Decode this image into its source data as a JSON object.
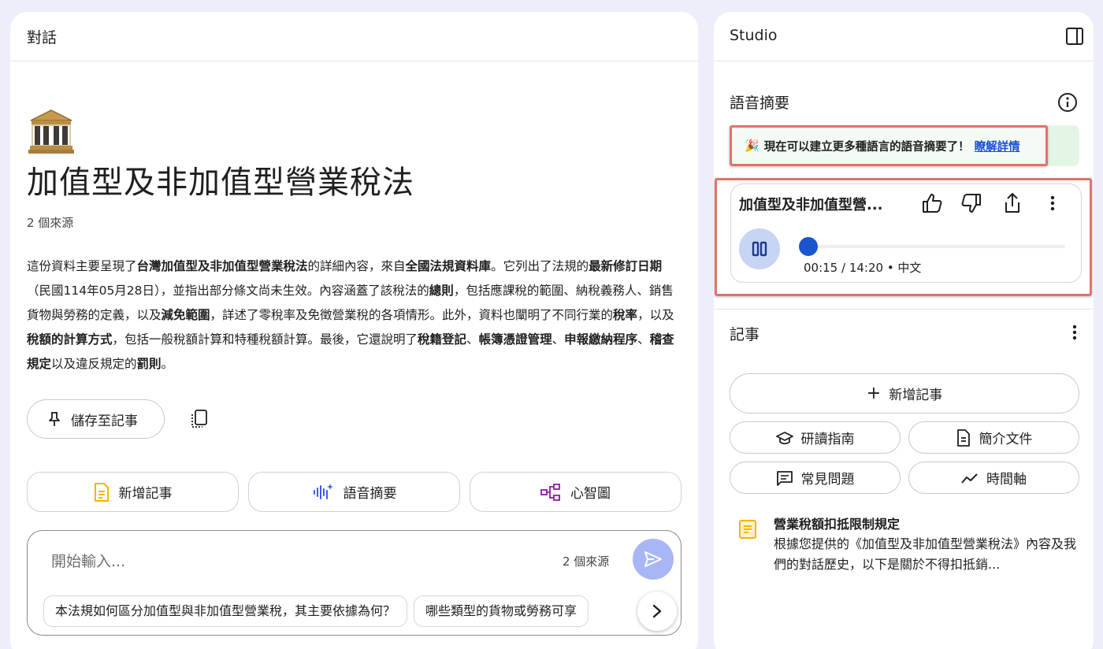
{
  "chat": {
    "header": "對話",
    "notebook_title": "加值型及非加值型營業稅法",
    "source_count": "2 個來源",
    "summary_segments": [
      {
        "text": "這份資料主要呈現了",
        "bold": false
      },
      {
        "text": "台灣加值型及非加值型營業稅法",
        "bold": true
      },
      {
        "text": "的詳細內容，來自",
        "bold": false
      },
      {
        "text": "全國法規資料庫",
        "bold": true
      },
      {
        "text": "。它列出了法規的",
        "bold": false
      },
      {
        "text": "最新修訂日期",
        "bold": true
      },
      {
        "text": "（民國114年05月28日），並指出部分條文尚未生效。內容涵蓋了該稅法的",
        "bold": false
      },
      {
        "text": "總則",
        "bold": true
      },
      {
        "text": "，包括應課稅的範圍、納稅義務人、銷售貨物與勞務的定義，以及",
        "bold": false
      },
      {
        "text": "減免範圍",
        "bold": true
      },
      {
        "text": "，詳述了零稅率及免徵營業稅的各項情形。此外，資料也闡明了不同行業的",
        "bold": false
      },
      {
        "text": "稅率",
        "bold": true
      },
      {
        "text": "，以及",
        "bold": false
      },
      {
        "text": "稅額的計算方式",
        "bold": true
      },
      {
        "text": "，包括一般稅額計算和特種稅額計算。最後，它還說明了",
        "bold": false
      },
      {
        "text": "稅籍登記",
        "bold": true
      },
      {
        "text": "、",
        "bold": false
      },
      {
        "text": "帳簿憑證管理",
        "bold": true
      },
      {
        "text": "、",
        "bold": false
      },
      {
        "text": "申報繳納程序",
        "bold": true
      },
      {
        "text": "、",
        "bold": false
      },
      {
        "text": "稽查規定",
        "bold": true
      },
      {
        "text": "以及違反規定的",
        "bold": false
      },
      {
        "text": "罰則",
        "bold": true
      },
      {
        "text": "。",
        "bold": false
      }
    ],
    "save_label": "儲存至記事",
    "actions": [
      {
        "label": "新增記事",
        "icon": "note-icon"
      },
      {
        "label": "語音摘要",
        "icon": "audio-wave-icon"
      },
      {
        "label": "心智圖",
        "icon": "mind-map-icon"
      }
    ],
    "composer": {
      "placeholder": "開始輸入...",
      "source_count": "2 個來源",
      "suggestions": [
        "本法規如何區分加值型與非加值型營業稅，其主要依據為何？",
        "哪些類型的貨物或勞務可享"
      ]
    }
  },
  "studio": {
    "title": "Studio",
    "audio_section_title": "語音摘要",
    "banner_text": "現在可以建立更多種語言的語音摘要了！",
    "banner_link": "瞭解詳情",
    "audio": {
      "title": "加值型及非加值型營...",
      "time": "00:15 / 14:20 • 中文",
      "progress": 0.0176
    },
    "notes_section_title": "記事",
    "add_note_label": "新增記事",
    "quick_actions": [
      {
        "label": "研讀指南",
        "icon": "graduation-cap-icon"
      },
      {
        "label": "簡介文件",
        "icon": "document-icon"
      },
      {
        "label": "常見問題",
        "icon": "faq-icon"
      },
      {
        "label": "時間軸",
        "icon": "timeline-icon"
      }
    ],
    "note": {
      "title": "營業稅額扣抵限制規定",
      "snippet": "根據您提供的《加值型及非加值型營業稅法》內容及我們的對話歷史，以下是關於不得扣抵銷..."
    }
  },
  "colors": {
    "background": "#eceef9",
    "accent_blue": "#1a55e0",
    "highlight_red": "#e0736a",
    "banner_green": "#e3f6e6",
    "note_yellow": "#f4b400"
  }
}
